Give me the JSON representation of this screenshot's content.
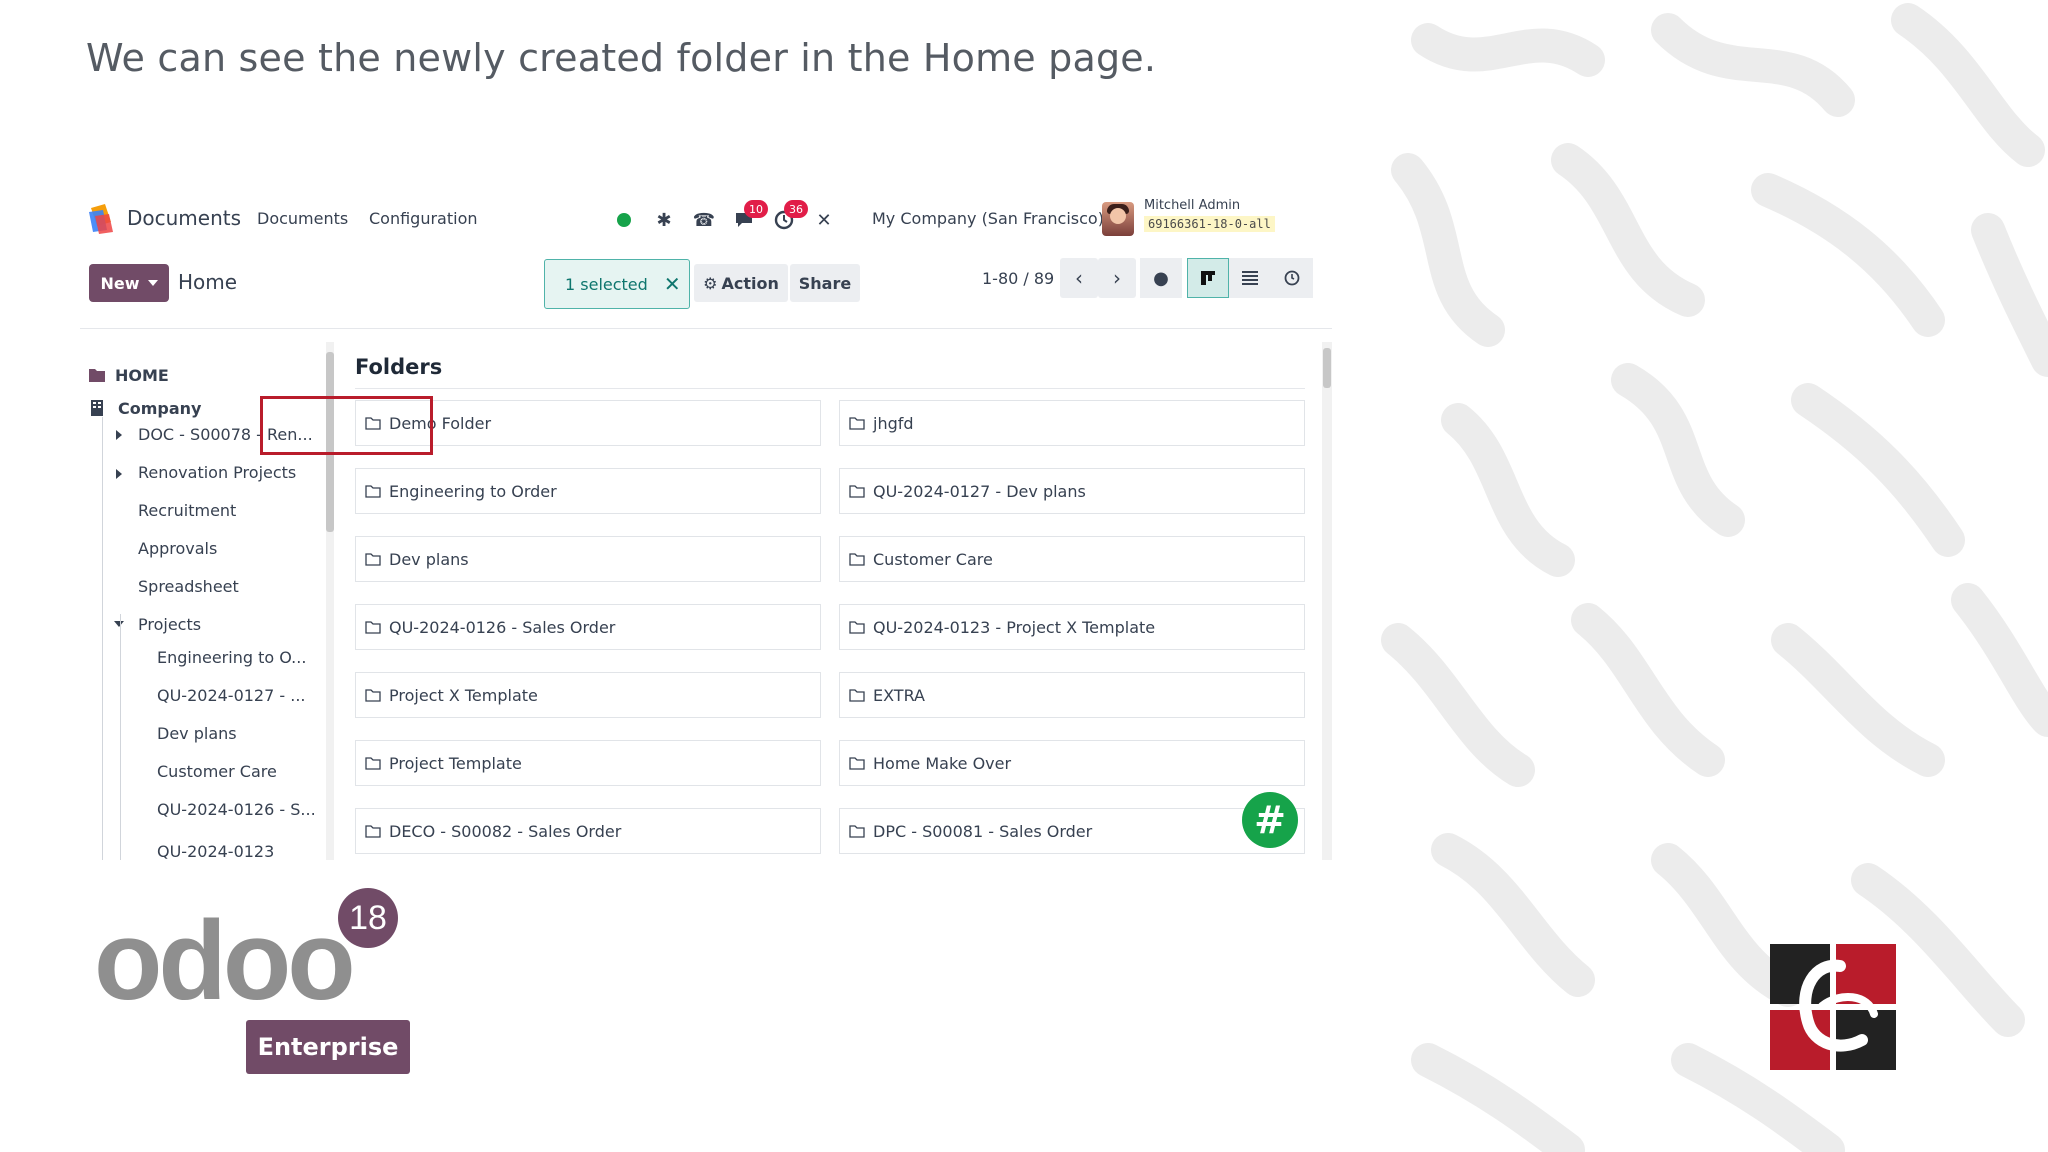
{
  "slide": {
    "caption": "We can see the newly created folder in the Home page."
  },
  "navbar": {
    "app_name": "Documents",
    "menu": [
      "Documents",
      "Configuration"
    ],
    "messages_badge": "10",
    "activities_badge": "36",
    "company": "My Company (San Francisco)",
    "user_name": "Mitchell Admin",
    "database": "69166361-18-0-all"
  },
  "control_panel": {
    "new_label": "New",
    "breadcrumb": "Home",
    "selected_label": "1 selected",
    "action_label": "Action",
    "share_label": "Share",
    "pager": "1-80 / 89"
  },
  "sidebar": {
    "root": "HOME",
    "company": "Company",
    "items": [
      "DOC - S00078 - Ren...",
      "Renovation Projects",
      "Recruitment",
      "Approvals",
      "Spreadsheet",
      "Projects"
    ],
    "project_children": [
      "Engineering to O...",
      "QU-2024-0127 - ...",
      "Dev plans",
      "Customer Care",
      "QU-2024-0126 - S...",
      "QU-2024-0123"
    ]
  },
  "main": {
    "section_title": "Folders",
    "folders_left": [
      "Demo Folder",
      "Engineering to Order",
      "Dev plans",
      "QU-2024-0126 - Sales Order",
      "Project X Template",
      "Project Template",
      "DECO - S00082 - Sales Order"
    ],
    "folders_right": [
      "jhgfd",
      "QU-2024-0127 - Dev plans",
      "Customer Care",
      "QU-2024-0123 - Project X Template",
      "EXTRA",
      "Home Make Over",
      "DPC - S00081 - Sales Order"
    ]
  },
  "branding": {
    "wordmark": "odoo",
    "version": "18",
    "edition": "Enterprise",
    "primary_color": "#714b67",
    "highlight_color": "#b91c2b"
  }
}
